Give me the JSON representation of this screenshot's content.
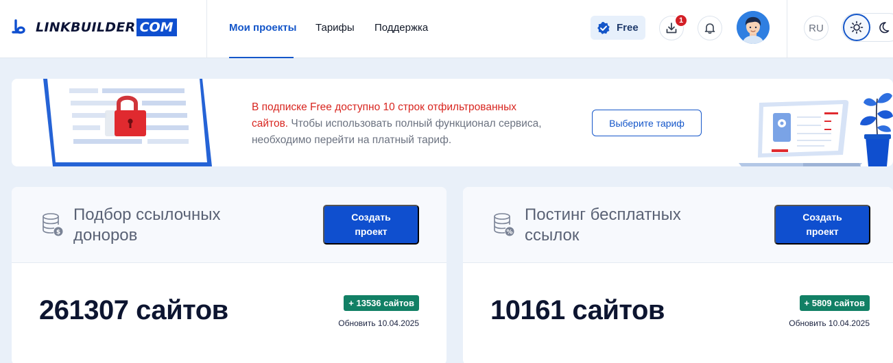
{
  "logo": {
    "text": "LINKBUILDER",
    "suffix": "COM",
    "icon": "linkbuilder-logo-icon"
  },
  "nav": [
    {
      "label": "Мои проекты",
      "active": true
    },
    {
      "label": "Тарифы",
      "active": false
    },
    {
      "label": "Поддержка",
      "active": false
    }
  ],
  "header": {
    "plan_label": "Free",
    "downloads_count": "1",
    "language": "RU",
    "icons": [
      "verified-check-icon",
      "download-icon",
      "bell-icon",
      "avatar",
      "sun-icon",
      "moon-icon"
    ]
  },
  "banner": {
    "highlight": "В подписке Free доступно 10 строк отфильтрованных сайтов.",
    "text": " Чтобы использовать полный функционал сервиса, необходимо перейти на платный тариф.",
    "button": "Выберите тариф"
  },
  "cards": [
    {
      "title": "Подбор ссылочных доноров",
      "button": "Создать проект",
      "count": "261307 сайтов",
      "badge": "+ 13536 сайтов",
      "updated": "Обновить 10.04.2025",
      "icon": "database-dollar-icon"
    },
    {
      "title": "Постинг бесплатных ссылок",
      "button": "Создать проект",
      "count": "10161 сайтов",
      "badge": "+ 5809 сайтов",
      "updated": "Обновить 10.04.2025",
      "icon": "database-percent-icon"
    }
  ],
  "colors": {
    "accent": "#0f4fcf",
    "danger": "#d8251f",
    "success": "#128065",
    "page_bg": "#e9f0f9"
  }
}
